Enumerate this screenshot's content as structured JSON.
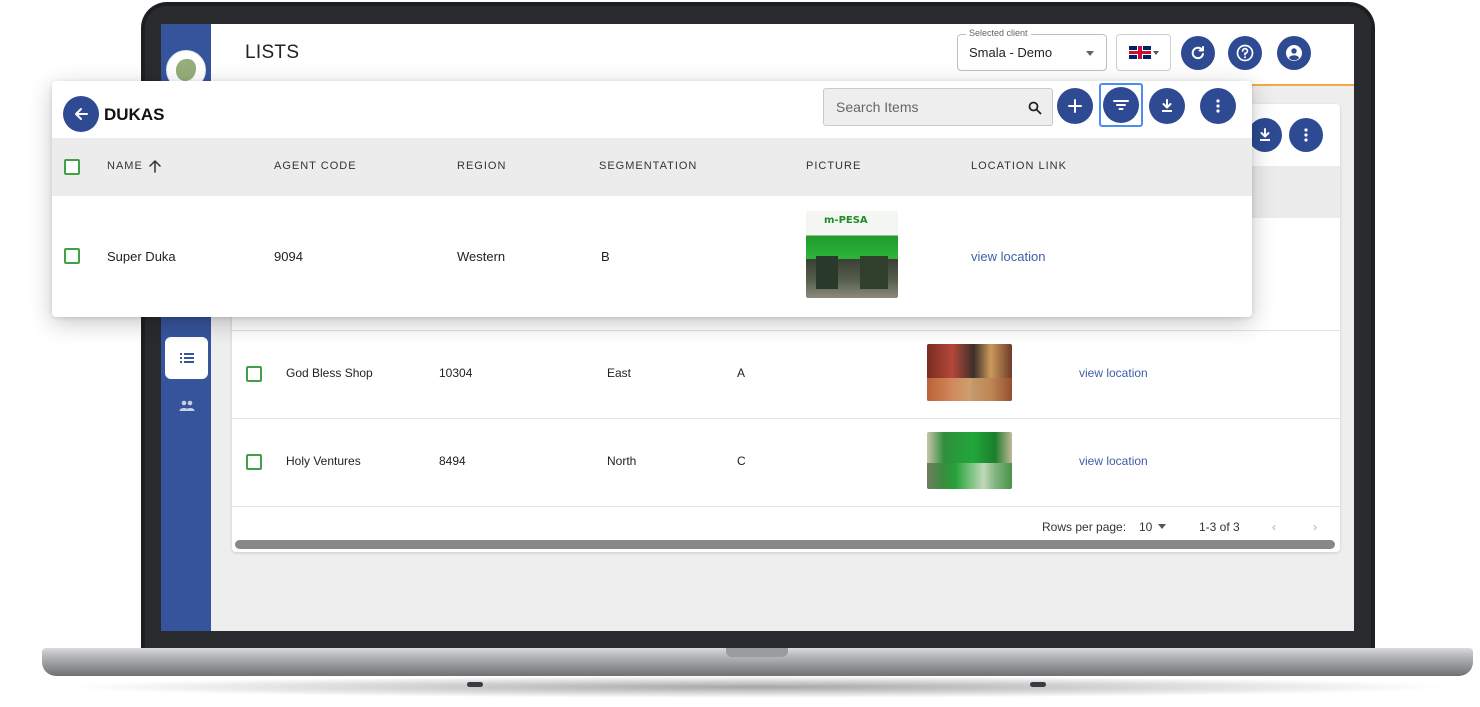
{
  "app": {
    "page_title": "LISTS",
    "client_select": {
      "legend": "Selected client",
      "value": "Smala - Demo"
    },
    "language": "en-GB",
    "accent_color": "#2e4a93",
    "sidebar_color": "#35549c"
  },
  "popup": {
    "title": "DUKAS",
    "search_placeholder": "Search Items",
    "columns": [
      "NAME",
      "AGENT CODE",
      "REGION",
      "SEGMENTATION",
      "PICTURE",
      "LOCATION LINK"
    ],
    "sort": {
      "column": "NAME",
      "direction": "ascending"
    },
    "rows": [
      {
        "name": "Super Duka",
        "agent_code": "9094",
        "region": "Western",
        "segmentation": "B",
        "picture": "mpesa-shop-photo",
        "location_link": "view location",
        "picture_sign": "m-PESA"
      }
    ]
  },
  "table": {
    "rows": [
      {
        "name": "God Bless Shop",
        "agent_code": "10304",
        "region": "East",
        "segmentation": "A",
        "picture": "shop-photo",
        "location_link": "view location"
      },
      {
        "name": "Holy Ventures",
        "agent_code": "8494",
        "region": "North",
        "segmentation": "C",
        "picture": "mpesa-shop-photo",
        "location_link": "view location"
      }
    ],
    "pagination": {
      "rows_per_page_label": "Rows per page:",
      "rows_per_page": "10",
      "range": "1-3 of 3"
    }
  }
}
